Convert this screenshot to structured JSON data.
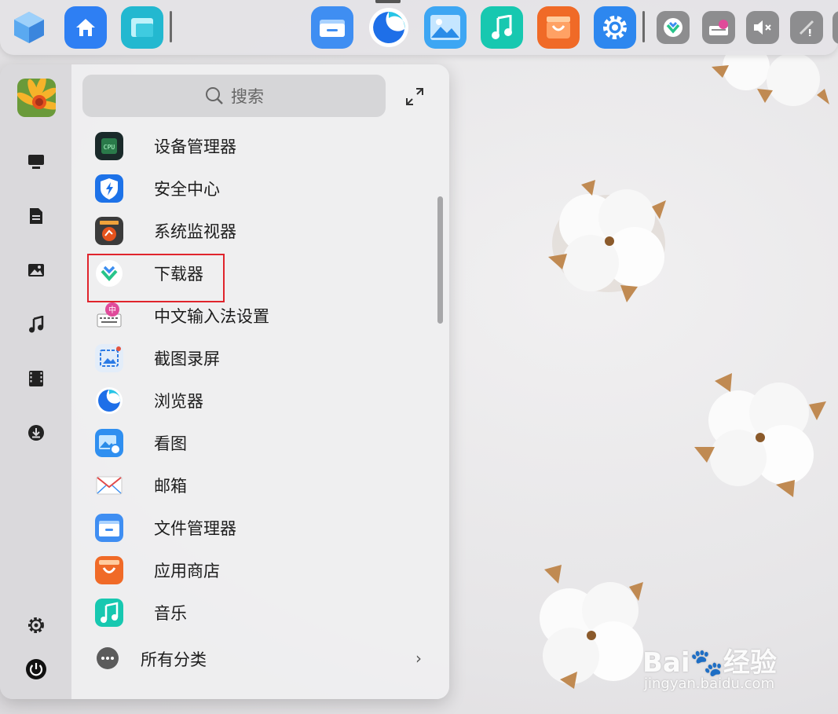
{
  "dock": {
    "apps": [
      {
        "name": "kylin-launcher-icon",
        "color": "#4a8fe0"
      },
      {
        "name": "home-icon",
        "color": "#2e7ff3"
      },
      {
        "name": "multitask-view-icon",
        "color": "#23b8d0"
      },
      {
        "name": "file-manager-icon",
        "color": "#3f8ef2"
      },
      {
        "name": "browser-icon",
        "color": "#1e6fe8"
      },
      {
        "name": "image-viewer-icon",
        "color": "#2c9df0"
      },
      {
        "name": "music-icon",
        "color": "#17c8b0"
      },
      {
        "name": "app-store-icon",
        "color": "#f06a27"
      },
      {
        "name": "settings-icon",
        "color": "#2d87ef"
      }
    ],
    "tray": [
      {
        "name": "downloader-tray-icon"
      },
      {
        "name": "input-method-tray-icon"
      },
      {
        "name": "volume-muted-icon"
      },
      {
        "name": "network-disconnected-icon"
      }
    ]
  },
  "menu": {
    "search": {
      "label": "搜索"
    },
    "sidebar": [
      {
        "name": "sidebar-all-apps-icon"
      },
      {
        "name": "sidebar-documents-icon"
      },
      {
        "name": "sidebar-pictures-icon"
      },
      {
        "name": "sidebar-music-icon"
      },
      {
        "name": "sidebar-videos-icon"
      },
      {
        "name": "sidebar-downloads-icon"
      }
    ],
    "apps": [
      {
        "label": "设备管理器",
        "icon": "device-manager-icon",
        "color": "#1a2a2a"
      },
      {
        "label": "安全中心",
        "icon": "security-center-icon",
        "color": "#1d72e8"
      },
      {
        "label": "系统监视器",
        "icon": "system-monitor-icon",
        "color": "#3b3b3b"
      },
      {
        "label": "下载器",
        "icon": "downloader-icon",
        "color": "#ffffff"
      },
      {
        "label": "中文输入法设置",
        "icon": "input-method-settings-icon",
        "color": "#eeeeee"
      },
      {
        "label": "截图录屏",
        "icon": "screenshot-icon",
        "color": "#e3edf9"
      },
      {
        "label": "浏览器",
        "icon": "browser-icon",
        "color": "#ffffff"
      },
      {
        "label": "看图",
        "icon": "image-viewer-icon",
        "color": "#2f8ff0"
      },
      {
        "label": "邮箱",
        "icon": "mail-icon",
        "color": "#f5f5f5"
      },
      {
        "label": "文件管理器",
        "icon": "file-manager-icon",
        "color": "#3f8ef2"
      },
      {
        "label": "应用商店",
        "icon": "app-store-icon",
        "color": "#f06a27"
      },
      {
        "label": "音乐",
        "icon": "music-icon",
        "color": "#17c8b0"
      }
    ],
    "highlighted_app": "下载器",
    "all_categories": {
      "label": "所有分类",
      "arrow": "›"
    }
  },
  "watermark": {
    "logo": "Bai",
    "logo_suffix": "经验",
    "url": "jingyan.baidu.com"
  }
}
